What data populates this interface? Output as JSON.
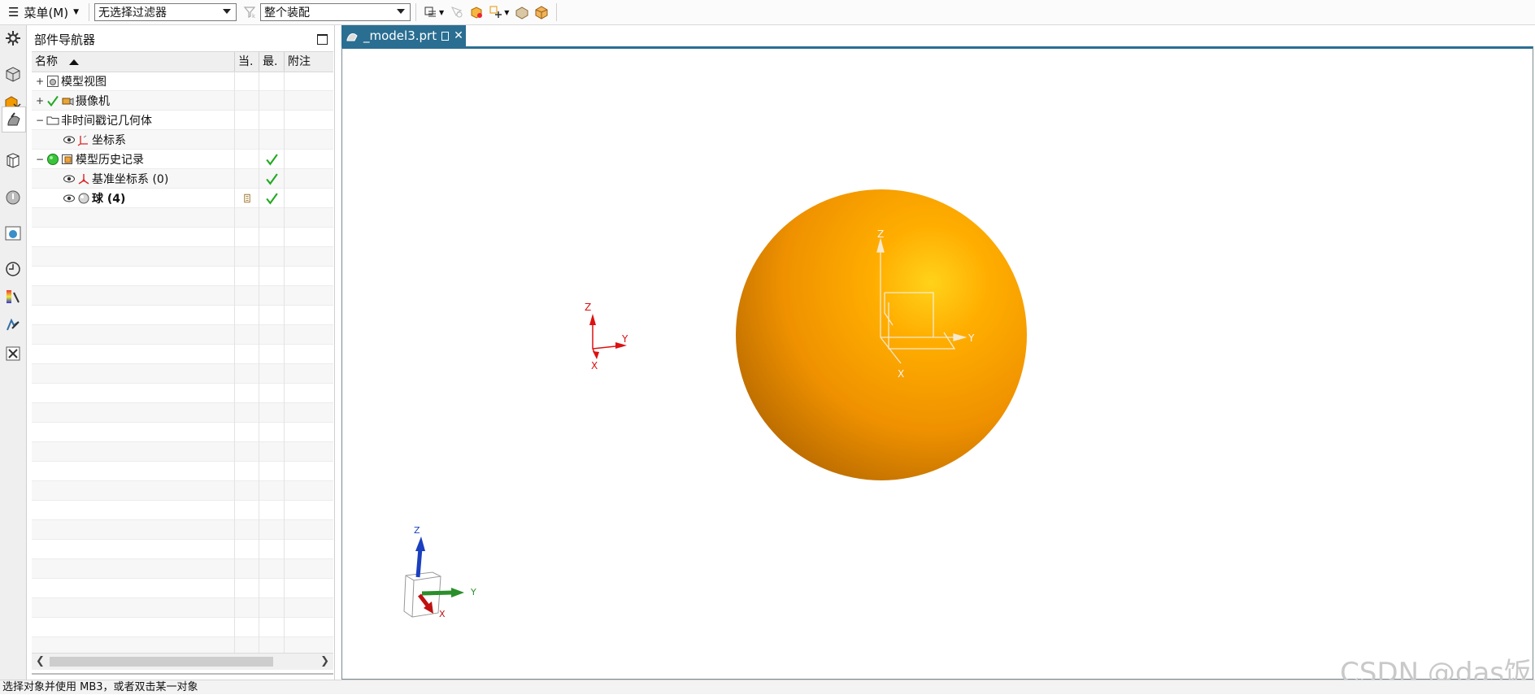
{
  "toolbar": {
    "menu_label": "菜单(M)",
    "selection_filter": "无选择过滤器",
    "assembly_scope": "整个装配",
    "icons": [
      "filter-icon",
      "snap-view-icon",
      "deselect-icon",
      "select-feature-icon",
      "select-point-icon",
      "show-hide-icon",
      "solid-display-icon"
    ]
  },
  "resource_bar": {
    "icons": [
      "settings-icon",
      "assembly-navigator-icon",
      "constraint-navigator-icon",
      "part-navigator-icon",
      "reuse-library-icon",
      "hd3d-tools-icon",
      "web-browser-icon",
      "history-icon",
      "process-studio-icon",
      "manufacturing-wizard-icon",
      "roles-icon"
    ]
  },
  "navigator": {
    "title": "部件导航器",
    "columns": {
      "name": "名称",
      "current": "当.",
      "latest": "最.",
      "note": "附注"
    },
    "rows": [
      {
        "label": "模型视图",
        "level": 0,
        "expander": "+",
        "icon": "model-views-icon",
        "checked": false,
        "latest": false,
        "bold": false,
        "eye": false
      },
      {
        "label": "摄像机",
        "level": 0,
        "expander": "+",
        "icon": "camera-icon",
        "checked": true,
        "latest": false,
        "bold": false,
        "eye": false
      },
      {
        "label": "非时间戳记几何体",
        "level": 0,
        "expander": "−",
        "icon": "folder-icon",
        "checked": false,
        "latest": false,
        "bold": false,
        "eye": false
      },
      {
        "label": "坐标系",
        "level": 1,
        "expander": "",
        "icon": "csys-icon",
        "checked": false,
        "latest": false,
        "bold": false,
        "eye": true
      },
      {
        "label": "模型历史记录",
        "level": 0,
        "expander": "−",
        "icon": "history-folder-icon",
        "checked": false,
        "latest": true,
        "bold": false,
        "eye": false,
        "status": "green"
      },
      {
        "label": "基准坐标系 (0)",
        "level": 1,
        "expander": "",
        "icon": "datum-csys-icon",
        "checked": false,
        "latest": true,
        "bold": false,
        "eye": true
      },
      {
        "label": "球 (4)",
        "level": 1,
        "expander": "",
        "icon": "sphere-icon",
        "checked": false,
        "latest": true,
        "bold": true,
        "eye": true,
        "current_marker": true
      }
    ],
    "empty_rows": 23
  },
  "graphics": {
    "tab_label": "_model3.prt",
    "axes": {
      "x": "X",
      "y": "Y",
      "z": "Z"
    },
    "sphere_color": "#f39a00"
  },
  "status": {
    "message": "选择对象并使用 MB3，或者双击某一对象"
  },
  "watermark": "CSDN @das饭"
}
